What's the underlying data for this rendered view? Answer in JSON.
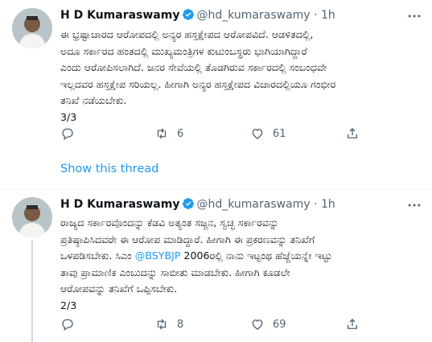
{
  "tweets": [
    {
      "name": "H D Kumaraswamy",
      "handle": "@hd_kumaraswamy",
      "dot": "·",
      "time": "1h",
      "text": "ಈ ಭ್ರಷ್ಟಾಚಾರದ ಆರೋಪದಲ್ಲಿ ಅನ್ಯರ ಹಸ್ತಕ್ಷೇಪದ ಆರೋಪವಿದೆ.  ಆಡಳಿತದಲ್ಲಿ,\nಅದೂ ಸರ್ಕಾರದ ಹಂತದಲ್ಲಿ ಮುಖ್ಯಮಂತ್ರಿಗಳ ಕುಟುಂಬಸ್ಥರು ಭಾಗಿಯಾಗಿದ್ದಾರೆ\nಎಂದು ಆರೋಪಿಸಲಾಗಿದೆ. ಜನರ ಸೇವೆಯಲ್ಲಿ ತೊಡಗಿರುವ ಸರ್ಕಾರದಲ್ಲಿ ಸಂಬಂಧವೇ\nಇಲ್ಲದವರ ಹಸ್ತಕ್ಷೇಪ ಸರಿಯಲ್ಲ. ಹೀಗಾಗಿ ಅನ್ಯರ ಹಸ್ತಕ್ಷೇಪದ ವಿಚಾರದಲ್ಲಿಯೂ ಗಂಭೀರ\nತನಿಖೆ ನಡೆಯಬೇಕು.\n3/3",
      "retweets": "6",
      "likes": "61"
    },
    {
      "name": "H D Kumaraswamy",
      "handle": "@hd_kumaraswamy",
      "dot": "·",
      "time": "1h",
      "text_part1": "ರಾಜ್ಯದ ಸರ್ಕಾರವೊಂದನ್ನು ಕೆಡವಿ ಅತ್ಯಂತ ಸಜ್ಜನ, ಸ್ವಚ್ಛ ಸರ್ಕಾರವನ್ನು\nಪ್ರತಿಷ್ಠಾಪಿಸಿದವರೇ ಈ ಆರೋಪ ಮಾಡಿದ್ದಾರೆ. ಹೀಗಾಗಿ ಈ ಪ್ರಕರಣವನ್ನು ತನಿಖೆಗೆ\nಒಳಪಡಿಸಬೇಕು. ಸಿಎಂ ",
      "mention": "@BSYBJP",
      "text_part2": " 2006ರಲ್ಲಿ ನಾನು ಇಟ್ಟಂಥ ಹೆಜ್ಜೆಯನ್ನೇ ಇಟ್ಟು\nತಾವು ಪ್ರಾಮಾಣಿಕ ಎಂಬುದನ್ನು ಸಾಬೀತು ಮಾಡಬೇಕು. ಹೀಗಾಗಿ ಕೂಡಲೇ\nಆರೋಪವನ್ನು ತನಿಖೆಗೆ ಒಪ್ಪಿಸಬೇಕು.\n2/3",
      "retweets": "8",
      "likes": "69"
    }
  ],
  "show_thread": "Show this thread",
  "colors": {
    "accent": "#1d9bf0",
    "muted": "#536471",
    "divider": "#eff3f4"
  },
  "icons": [
    "verified-badge-icon",
    "more-icon",
    "reply-icon",
    "retweet-icon",
    "like-icon",
    "share-icon"
  ]
}
